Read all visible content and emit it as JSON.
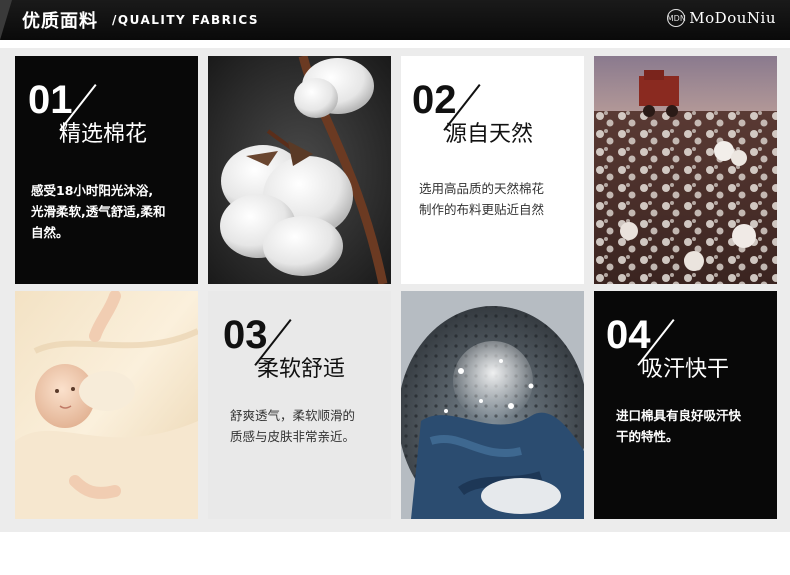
{
  "header": {
    "title_cn": "优质面料",
    "title_en": "/QUALITY FABRICS",
    "brand": "MoDouNiu",
    "brand_logo_text": "MDN"
  },
  "features": [
    {
      "number": "01",
      "title": "精选棉花",
      "lines": [
        "感受18小时阳光沐浴,",
        "光滑柔软,透气舒适,柔和",
        "自然。"
      ]
    },
    {
      "number": "02",
      "title": "源自天然",
      "lines": [
        "选用高品质的天然棉花",
        "制作的布料更贴近自然"
      ]
    },
    {
      "number": "03",
      "title": "柔软舒适",
      "lines": [
        "舒爽透气，柔软顺滑的",
        "质感与皮肤非常亲近。"
      ]
    },
    {
      "number": "04",
      "title": "吸汗快干",
      "lines": [
        "进口棉具有良好吸汗快",
        "干的特性。"
      ]
    }
  ],
  "photos": {
    "cotton_boll": "cotton-boll-photo",
    "cotton_field": "cotton-field-photo",
    "baby": "baby-photo",
    "washing_machine": "washing-machine-photo"
  }
}
